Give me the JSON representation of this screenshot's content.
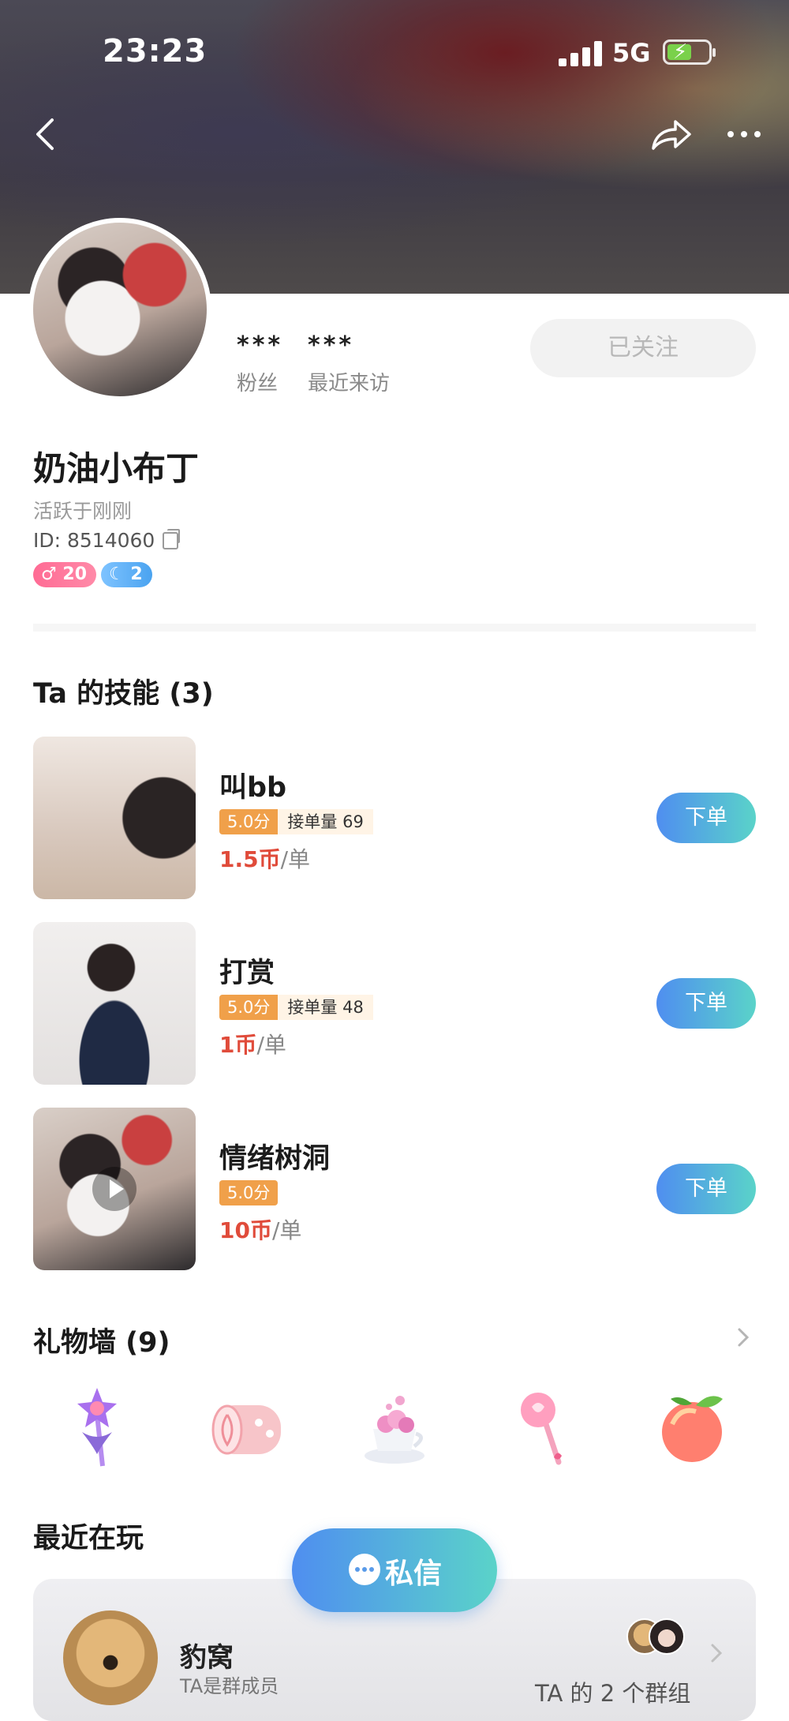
{
  "status_bar": {
    "time": "23:23",
    "network": "5G"
  },
  "profile": {
    "stats": [
      {
        "value": "***",
        "label": "粉丝"
      },
      {
        "value": "***",
        "label": "最近来访"
      }
    ],
    "follow_label": "已关注",
    "name": "奶油小布丁",
    "active_status": "活跃于刚刚",
    "id_text": "ID: 8514060",
    "badges": [
      {
        "icon": "male-icon",
        "text": "♂ 20",
        "color": "#ff6b94"
      },
      {
        "icon": "moon-icon",
        "text": "2",
        "color": "#4aa3f0"
      }
    ]
  },
  "skills": {
    "title": "Ta 的技能 (3)",
    "items": [
      {
        "name": "叫bb",
        "score": "5.0分",
        "orders": "接单量 69",
        "price": "1.5币",
        "unit": "/单",
        "button": "下单"
      },
      {
        "name": "打赏",
        "score": "5.0分",
        "orders": "接单量 48",
        "price": "1币",
        "unit": "/单",
        "button": "下单"
      },
      {
        "name": "情绪树洞",
        "score": "5.0分",
        "orders": "",
        "price": "10币",
        "unit": "/单",
        "button": "下单"
      }
    ]
  },
  "gift_wall": {
    "title": "礼物墙 (9)",
    "gifts": [
      "magic-wand-icon",
      "cake-roll-icon",
      "teacup-icon",
      "heart-wand-icon",
      "peach-icon"
    ]
  },
  "recent_play": {
    "title": "最近在玩",
    "group_name": "豹窝",
    "group_sub": "TA是群成员",
    "group_count": "TA 的 2 个群组"
  },
  "dm_button": "私信",
  "colors": {
    "accent_start": "#4f8ef0",
    "accent_end": "#5ad3c9",
    "price": "#e04b3a",
    "score": "#f0a04a"
  }
}
